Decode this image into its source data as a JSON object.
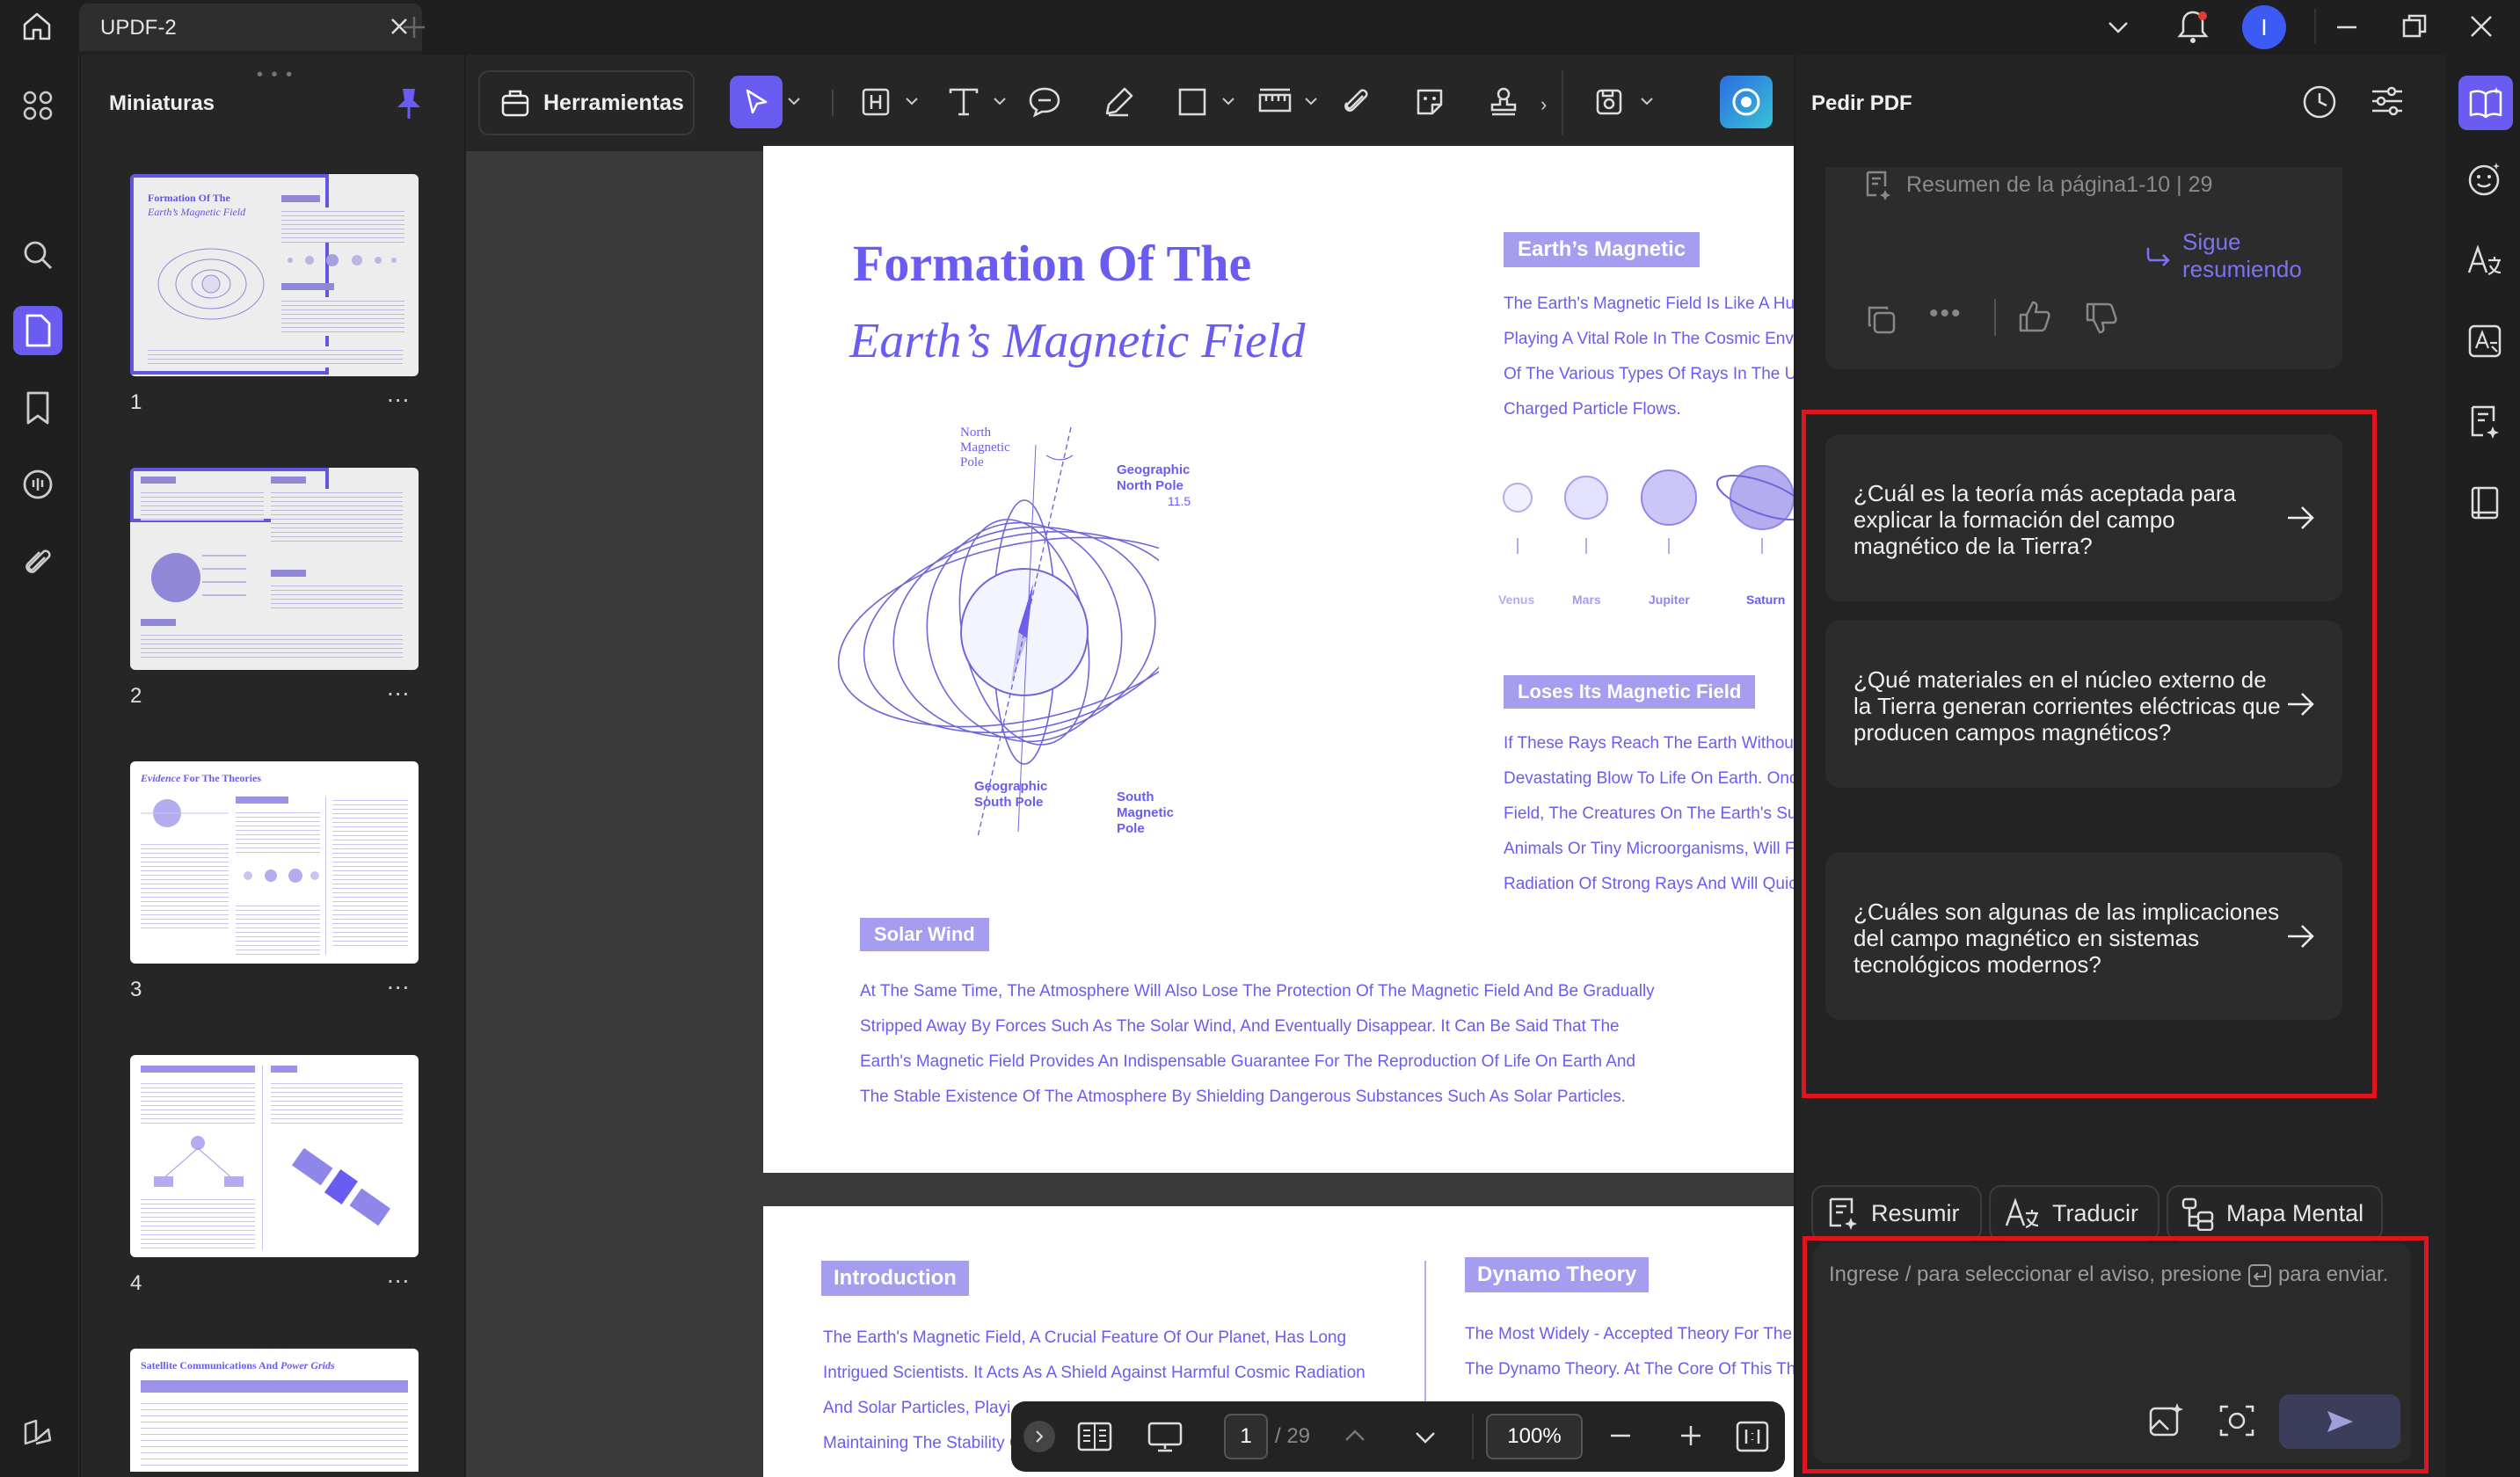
{
  "app": {
    "tab_title": "UPDF-2",
    "avatar_letter": "I"
  },
  "thumbnails": {
    "header": "Miniaturas",
    "items": [
      {
        "number": "1",
        "more": "..."
      },
      {
        "number": "2",
        "more": "..."
      },
      {
        "number": "3",
        "more": "..."
      },
      {
        "number": "4",
        "more": "..."
      }
    ]
  },
  "toolbar": {
    "tools_label": "Herramientas",
    "overflow": "›"
  },
  "page1": {
    "title_line1": "Formation Of The",
    "title_line2": "Earth’s Magnetic Field",
    "diagram_labels": {
      "north_magnetic_pole": "North Magnetic Pole",
      "geographic_north_pole": "Geographic North Pole",
      "angle": "11.5",
      "geographic_south_pole": "Geographic South Pole",
      "south_magnetic_pole": "South Magnetic Pole"
    },
    "earth_magnetic_tag": "Earth’s Magnetic",
    "earth_magnetic_lines": [
      "The Earth's Magnetic Field Is Like A Hu",
      "Playing A Vital Role In The Cosmic Env",
      "Of The Various Types Of Rays In The U",
      "Charged Particle Flows."
    ],
    "planets": [
      "Venus",
      "Mars",
      "Jupiter",
      "Saturn"
    ],
    "loses_tag": "Loses Its Magnetic Field",
    "loses_lines": [
      "If These Rays Reach The Earth Without",
      "Devastating Blow To Life On Earth. Onc",
      "Field, The Creatures On The Earth's Su",
      "Animals Or Tiny Microorganisms, Will F",
      "Radiation Of Strong Rays And Will Quic"
    ],
    "solar_tag": "Solar Wind",
    "solar_lines": [
      "At The Same Time, The Atmosphere Will Also Lose The Protection Of The Magnetic Field And Be Gradually",
      "Stripped Away By Forces Such As The Solar Wind, And Eventually Disappear. It Can Be Said That The",
      "Earth's Magnetic Field Provides An Indispensable Guarantee For The Reproduction Of Life On Earth And",
      "The Stable Existence Of The Atmosphere By Shielding Dangerous Substances Such As Solar Particles."
    ]
  },
  "page2": {
    "intro_tag": "Introduction",
    "intro_lines": [
      "The Earth's Magnetic Field, A Crucial Feature Of Our Planet, Has Long",
      "Intrigued Scientists. It Acts As A Shield Against Harmful Cosmic Radiation",
      "And Solar Particles, Playi",
      "Maintaining The Stability C"
    ],
    "dynamo_tag": "Dynamo Theory",
    "dynamo_lines": [
      "The Most Widely - Accepted Theory For The",
      "The Dynamo Theory. At The Core Of This Th"
    ]
  },
  "page_nav": {
    "current_page": "1",
    "total_pages": "/ 29",
    "zoom": "100%"
  },
  "ai_panel": {
    "title": "Pedir PDF",
    "summary_ref": "Resumen de la página1-10 | 29",
    "continue_summary": "Sigue resumiendo",
    "suggestions": [
      "¿Cuál es la teoría más aceptada para explicar la formación del campo magnético de la Tierra?",
      "¿Qué materiales en el núcleo externo de la Tierra generan corrientes eléctricas que producen campos magnéticos?",
      "¿Cuáles son algunas de las implicaciones del campo magnético en sistemas tecnológicos modernos?"
    ],
    "chips": {
      "summarize": "Resumir",
      "translate": "Traducir",
      "mind_map": "Mapa Mental"
    },
    "input_placeholder_before": "Ingrese / para seleccionar el aviso, presione",
    "input_placeholder_after": "para enviar."
  },
  "colors": {
    "accent": "#6a5cf0",
    "highlight_box": "#e0141e",
    "panel_bg": "#232323"
  }
}
